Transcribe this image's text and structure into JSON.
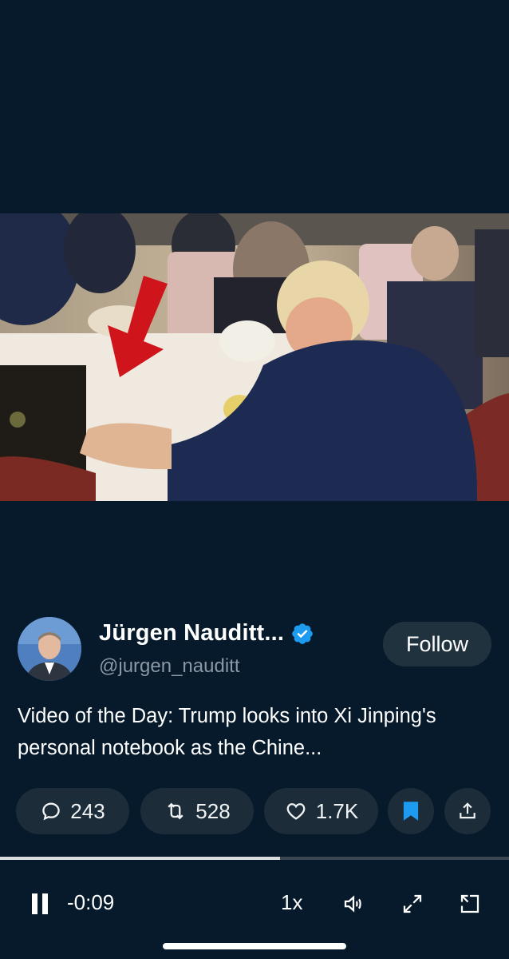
{
  "video": {
    "description_icon": "play-video"
  },
  "author": {
    "name": "Jürgen Nauditt...",
    "handle": "@jurgen_nauditt",
    "follow_label": "Follow",
    "verified_color": "#1d9bf0"
  },
  "tweet": {
    "text": "Video of the Day: Trump looks into Xi Jinping's personal notebook as the Chine..."
  },
  "actions": {
    "replies": "243",
    "retweets": "528",
    "likes": "1.7K",
    "bookmark_color": "#1d9bf0"
  },
  "player": {
    "progress": 0.55,
    "time_remaining": "-0:09",
    "speed": "1x"
  },
  "icons": {
    "reply": "reply-icon",
    "retweet": "retweet-icon",
    "like": "heart-icon",
    "bookmark": "bookmark-icon",
    "share": "share-icon",
    "pause": "pause-icon",
    "volume": "volume-icon",
    "fullscreen": "fullscreen-icon",
    "pip": "pip-icon"
  }
}
